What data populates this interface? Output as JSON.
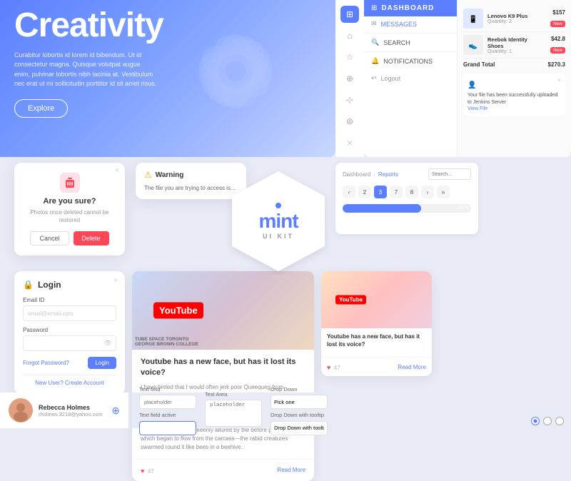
{
  "hero": {
    "title": "Creativity",
    "description": "Curabitur lobortis id lorem id bibendum. Ut id consectetur magna. Quisque volutpat augue enim, pulvinar lobortis nibh lacinia at. Vestibulum nec erat ut mi sollicitudin porttitor id sit amet risus.",
    "explore_btn": "Explore"
  },
  "nav": {
    "items": [
      "⊞",
      "⌂",
      "☆",
      "⊕",
      "×"
    ],
    "logout": "Logout"
  },
  "dashboard": {
    "title": "DASHBOARD",
    "menu_items": [
      {
        "icon": "✉",
        "label": "MESSAGES"
      },
      {
        "icon": "🔍",
        "label": "SEARCH"
      },
      {
        "icon": "🔔",
        "label": "NOTIFICATIONS"
      }
    ]
  },
  "cart": {
    "items": [
      {
        "name": "Lenovo K9 Plus",
        "qty": "Quantity: 2",
        "price": "$157",
        "badge": "New"
      },
      {
        "name": "Reebok Identity Shoes",
        "qty": "Quantity: 1",
        "price": "$42.8",
        "badge": "New"
      }
    ],
    "grand_total_label": "Grand Total",
    "grand_total_value": "$270.3"
  },
  "notification": {
    "text": "Your file has been successfully uploaded to Jenkins Server",
    "link": "View File"
  },
  "delete_dialog": {
    "title": "Are you sure?",
    "text": "Photos once deleted cannot be restored",
    "cancel": "Cancel",
    "delete": "Delete"
  },
  "warning": {
    "title": "Warning",
    "text": "The file you are trying to access is..."
  },
  "mint": {
    "name": "mint",
    "sub": "UI KIT"
  },
  "breadcrumb": {
    "items": [
      "Dashboard",
      "Reports"
    ]
  },
  "pagination": {
    "pages": [
      "2",
      "3",
      "7",
      "8"
    ]
  },
  "progress": {
    "value": 61,
    "label": "61%"
  },
  "login": {
    "title": "Login",
    "email_label": "Email ID",
    "email_placeholder": "email@email.com",
    "password_label": "Password",
    "forgot": "Forgot Password?",
    "login_btn": "Login",
    "create": "New User? Create Account"
  },
  "blog_large": {
    "title": "Youtube has a new face, but has it lost its voice?",
    "text": "I have hinted that I would often jerk poor Queequeg from between the whale and the ship—where he would occasionally fall, from the incessant rolling and swaying of both. But this was not the only jamming jeopardy he was exposed to. Unappalled by the massacre made upon them during the night, the sharks now freshly and more keenly allured by the before pent blood which began to flow from the carcass—the rabid creatures swarmed round it like bees in a beehive.",
    "read_more": "Read More",
    "likes": "47"
  },
  "blog_small": {
    "title": "Youtube has a new face, but has it lost its voice?",
    "read_more": "Read More",
    "likes": "47"
  },
  "profile": {
    "name": "Rebecca Holmes",
    "email": "rholmes.3218@yahoo.com"
  },
  "form_fields": {
    "text_field_label": "Text field",
    "text_field_placeholder": "placeholder",
    "text_field_active_label": "Text field active",
    "text_area_label": "Text Area",
    "text_area_placeholder": "placeholder"
  },
  "dropdown": {
    "label": "Drop Down",
    "placeholder": "Pick one",
    "sub_label": "Drop Down with tooltip"
  }
}
